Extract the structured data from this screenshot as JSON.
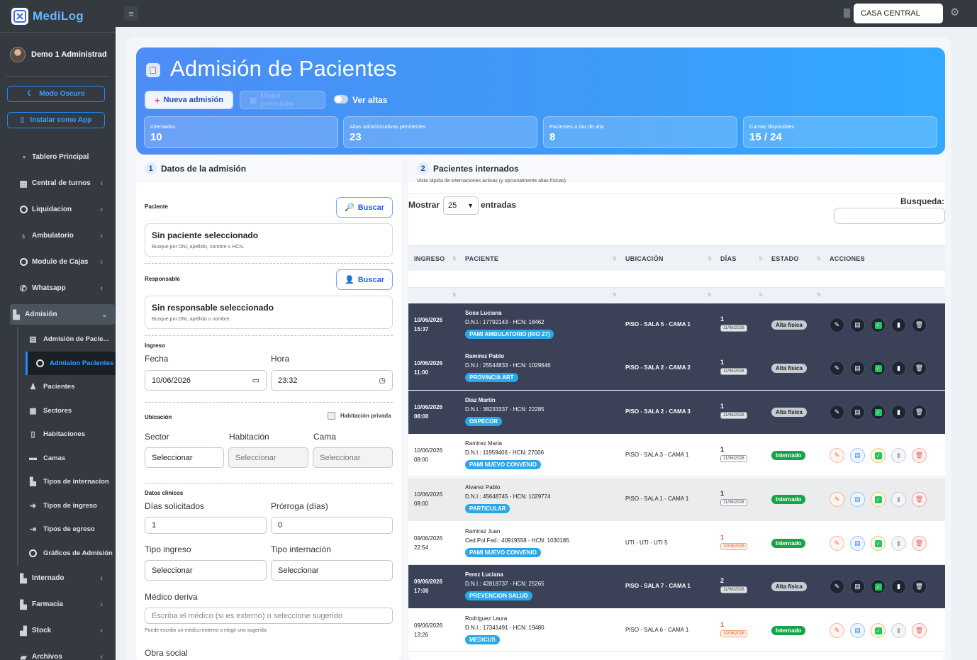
{
  "app": {
    "name": "MediLog",
    "user": "Demo 1 Administrad",
    "branch": "CASA CENTRAL"
  },
  "sidebar": {
    "dark_mode": "Modo Oscuro",
    "install": "Instalar como App",
    "items": [
      {
        "label": "Tablero Principal",
        "icon": "dashboard-icon"
      },
      {
        "label": "Central de turnos",
        "icon": "calendar-icon"
      },
      {
        "label": "Liquidacion",
        "icon": "circle-icon"
      },
      {
        "label": "Ambulatorio",
        "icon": "stethoscope-icon"
      },
      {
        "label": "Modulo de Cajas",
        "icon": "circle-icon"
      },
      {
        "label": "Whatsapp",
        "icon": "whatsapp-icon"
      },
      {
        "label": "Admisión",
        "icon": "hospital-icon"
      },
      {
        "label": "Internado",
        "icon": "hospital-icon"
      },
      {
        "label": "Farmacia",
        "icon": "hospital-icon"
      },
      {
        "label": "Stock",
        "icon": "boxes-icon"
      },
      {
        "label": "Archivos",
        "icon": "folder-icon"
      }
    ],
    "sub": [
      {
        "label": "Admisión de Pacie..."
      },
      {
        "label": "Admision Pacientes v"
      },
      {
        "label": "Pacientes"
      },
      {
        "label": "Sectores"
      },
      {
        "label": "Habitaciones"
      },
      {
        "label": "Camas"
      },
      {
        "label": "Tipos de internacion"
      },
      {
        "label": "Tipos de ingreso"
      },
      {
        "label": "Tipos de egreso"
      },
      {
        "label": "Gráficos de Admisión"
      }
    ]
  },
  "hero": {
    "title": "Admisión de Pacientes",
    "new_btn": "Nueva admisión",
    "map_btn": "Mapa premium",
    "ver_altas": "Ver altas",
    "stats": [
      {
        "label": "Internados",
        "value": "10"
      },
      {
        "label": "Altas administrativas pendientes",
        "value": "23"
      },
      {
        "label": "Pacientes a dar de alta",
        "value": "8"
      },
      {
        "label": "Camas disponibles",
        "value": "15 / 24"
      }
    ]
  },
  "form": {
    "step": "1",
    "title": "Datos de la admisión",
    "paciente_label": "Paciente",
    "buscar": "Buscar",
    "paciente_empty": "Sin paciente seleccionado",
    "paciente_hint": "Busque por DNI, apellido, nombre o HCN.",
    "responsable_label": "Responsable",
    "responsable_empty": "Sin responsable seleccionado",
    "responsable_hint": "Busque por DNI, apellido o nombre.",
    "ingreso_label": "Ingreso",
    "fecha": "Fecha",
    "hora": "Hora",
    "fecha_val": "10/06/2026",
    "hora_val": "23:32",
    "ubicacion": "Ubicación",
    "hab_privada": "Habitación privada",
    "sector": "Sector",
    "habitacion": "Habitación",
    "cama": "Cama",
    "seleccionar": "Seleccionar",
    "clinicos": "Datos clínicos",
    "dias_sol": "Días solicitados",
    "prorroga": "Prórroga (días)",
    "dias_val": "1",
    "prorroga_val": "0",
    "tipo_ingreso": "Tipo ingreso",
    "tipo_internacion": "Tipo internación",
    "medico": "Médico deriva",
    "medico_ph": "Escriba el médico (si es externo) o seleccione sugerido",
    "medico_hint": "Puede escribir un médico externo o elegir uno sugerido.",
    "obra_social": "Obra social"
  },
  "table": {
    "step": "2",
    "title": "Pacientes internados",
    "subtitle": "Vista rápida de internaciones activas (y opcionalmente altas físicas).",
    "mostrar": "Mostrar",
    "entradas": "entradas",
    "page_size": "25",
    "busqueda": "Busqueda:",
    "headers": [
      "INGRESO",
      "PACIENTE",
      "UBICACIÓN",
      "DÍAS",
      "ESTADO",
      "ACCIONES"
    ],
    "rows": [
      {
        "style": "dark",
        "date": "10/06/2026",
        "time": "15:37",
        "name": "Sosa Luciana",
        "dni": "D.N.I.: 17792143 - HCN: 18462",
        "obra": "PAMI AMBULATORIO (RIO 27)",
        "ubi": "PISO - SALA 5 - CAMA 1",
        "dias": "1",
        "ddate": "11/06/2026",
        "red": false,
        "estado": "Alta física"
      },
      {
        "style": "dark",
        "date": "10/06/2026",
        "time": "11:00",
        "name": "Ramirez Pablo",
        "dni": "D.N.I.: 25544833 - HCN: 1029646",
        "obra": "PROVINCIA ART",
        "ubi": "PISO - SALA 2 - CAMA 2",
        "dias": "1",
        "ddate": "11/06/2026",
        "red": false,
        "estado": "Alta física"
      },
      {
        "style": "dark",
        "date": "10/06/2026",
        "time": "08:00",
        "name": "Diaz Martin",
        "dni": "D.N.I.: 38233337 - HCN: 22285",
        "obra": "OSPECOR",
        "ubi": "PISO - SALA 2 - CAMA 3",
        "dias": "1",
        "ddate": "11/06/2026",
        "red": false,
        "estado": "Alta física"
      },
      {
        "style": "light",
        "date": "10/06/2026",
        "time": "08:00",
        "name": "Ramirez Maria",
        "dni": "D.N.I.: 11959406 - HCN: 27006",
        "obra": "PAMI NUEVO CONVENIO",
        "ubi": "PISO - SALA 3 - CAMA 1",
        "dias": "1",
        "ddate": "11/06/2026",
        "red": false,
        "estado": "Internado"
      },
      {
        "style": "gray",
        "date": "10/06/2026",
        "time": "08:00",
        "name": "Alvarez Pablo",
        "dni": "D.N.I.: 45648745 - HCN: 1029774",
        "obra": "PARTICULAR",
        "ubi": "PISO - SALA 1 - CAMA 1",
        "dias": "1",
        "ddate": "11/06/2026",
        "red": false,
        "estado": "Internado"
      },
      {
        "style": "light",
        "date": "09/06/2026",
        "time": "22:54",
        "name": "Ramirez Juan",
        "dni": "Ced.Pol.Fed.: 40919558 - HCN: 1030185",
        "obra": "PAMI NUEVO CONVENIO",
        "ubi": "UTI - UTI - UTI 5",
        "dias": "1",
        "ddate": "10/06/2026",
        "red": true,
        "estado": "Internado"
      },
      {
        "style": "dark",
        "date": "09/06/2026",
        "time": "17:00",
        "name": "Perez Luciana",
        "dni": "D.N.I.: 42818737 - HCN: 25265",
        "obra": "PREVENCION SALUD",
        "ubi": "PISO - SALA 7 - CAMA 1",
        "dias": "2",
        "ddate": "11/06/2026",
        "red": false,
        "estado": "Alta física"
      },
      {
        "style": "light",
        "date": "09/06/2026",
        "time": "13:26",
        "name": "Rodriguez Laura",
        "dni": "D.N.I.: 17341491 - HCN: 19480",
        "obra": "MEDICUS",
        "ubi": "PISO - SALA 6 - CAMA 1",
        "dias": "1",
        "ddate": "10/06/2026",
        "red": true,
        "estado": "Internado"
      }
    ]
  },
  "colors": {
    "accent": "#3d9af7",
    "sidebar": "#343a40",
    "dark_row": "#3b4157",
    "badge_obra": "#2aa7e8",
    "badge_internado": "#16a34a"
  }
}
